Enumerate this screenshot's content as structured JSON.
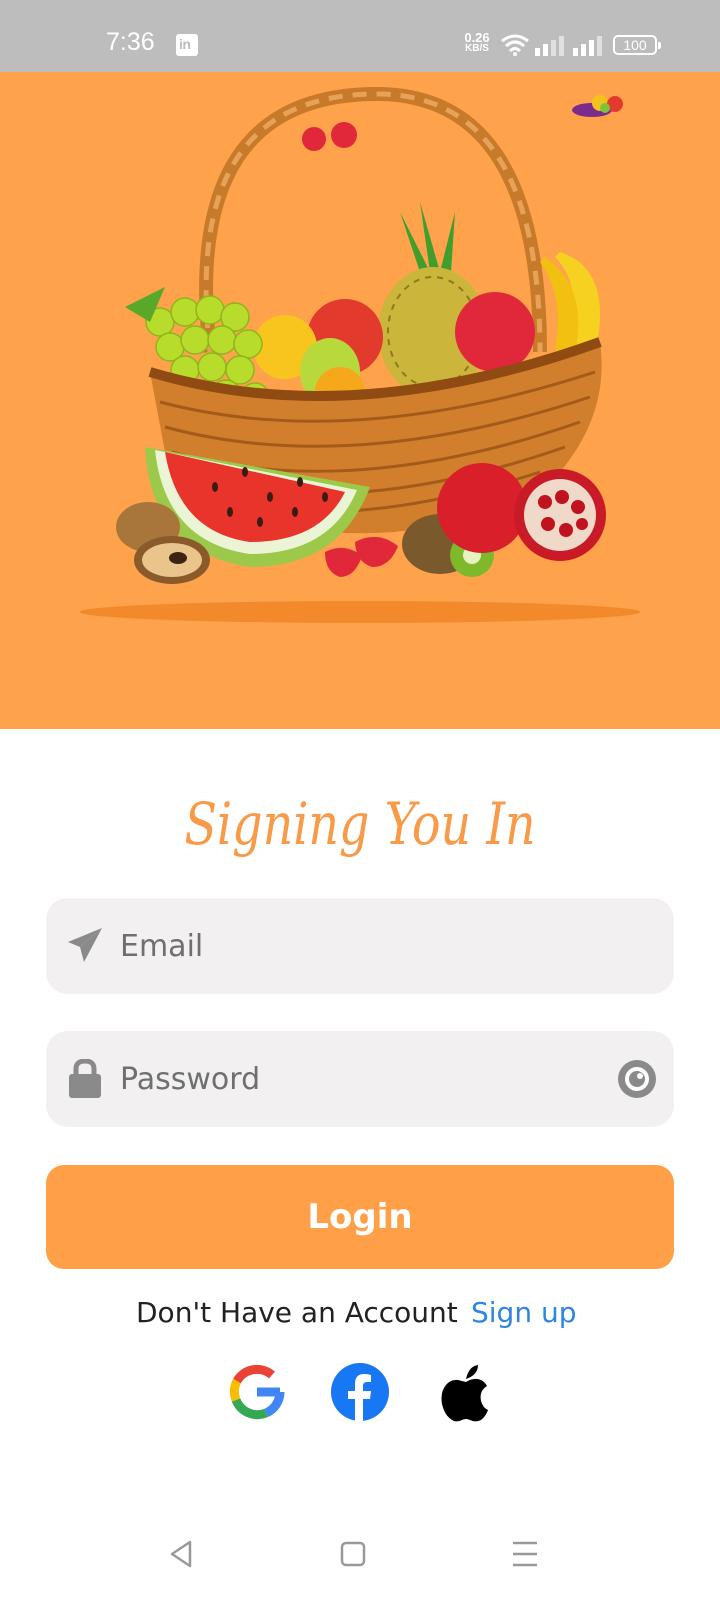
{
  "status_bar": {
    "time": "7:36",
    "app_notification_icon": "linkedin-icon",
    "network_speed_value": "0.26",
    "network_speed_unit": "KB/S",
    "battery": "100"
  },
  "hero": {
    "image_description": "fruit-basket-illustration"
  },
  "form": {
    "title": "Signing You In",
    "email_placeholder": "Email",
    "password_placeholder": "Password",
    "login_label": "Login"
  },
  "account": {
    "prompt": "Don't Have an Account",
    "signup_label": "Sign up"
  },
  "social": {
    "icons": [
      "google-icon",
      "facebook-icon",
      "apple-icon"
    ]
  },
  "colors": {
    "accent": "#ffa24c",
    "link": "#2e86de",
    "field_bg": "#f2f0f1"
  }
}
